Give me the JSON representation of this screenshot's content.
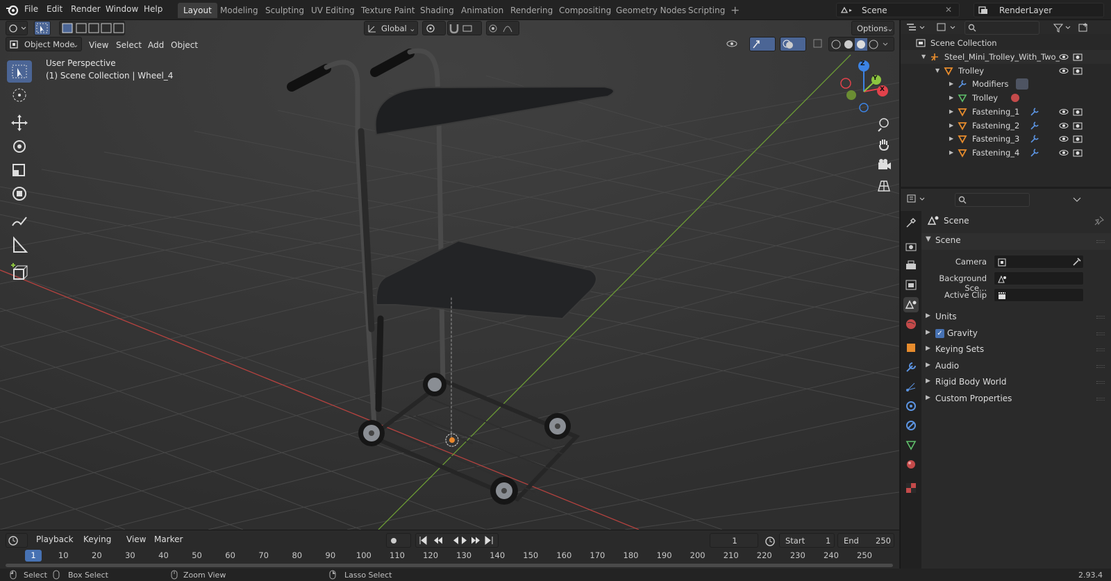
{
  "menus": [
    "File",
    "Edit",
    "Render",
    "Window",
    "Help"
  ],
  "workspace_tabs": [
    "Layout",
    "Modeling",
    "Sculpting",
    "UV Editing",
    "Texture Paint",
    "Shading",
    "Animation",
    "Rendering",
    "Compositing",
    "Geometry Nodes",
    "Scripting"
  ],
  "active_tab": "Layout",
  "scene_name": "Scene",
  "view_layer": "RenderLayer",
  "viewport": {
    "transform_orientation": "Global",
    "options_label": "Options",
    "mode": "Object Mode",
    "header_menus": [
      "View",
      "Select",
      "Add",
      "Object"
    ],
    "perspective_label": "User Perspective",
    "collection_info": "(1) Scene Collection | Wheel_4",
    "gizmo_axes": {
      "x": "X",
      "y": "Y",
      "z": "Z"
    }
  },
  "outliner": {
    "root": "Scene Collection",
    "rows": [
      {
        "label": "Steel_Mini_Trolley_With_Two_",
        "icon": "empty-icon"
      },
      {
        "label": "Trolley",
        "icon": "object-icon"
      },
      {
        "label": "Modifiers",
        "icon": "wrench-icon"
      },
      {
        "label": "Trolley",
        "icon": "mesh-data-icon"
      },
      {
        "label": "Fastening_1",
        "icon": "object-icon"
      },
      {
        "label": "Fastening_2",
        "icon": "object-icon"
      },
      {
        "label": "Fastening_3",
        "icon": "object-icon"
      },
      {
        "label": "Fastening_4",
        "icon": "object-icon"
      }
    ]
  },
  "properties": {
    "header": "Scene",
    "panel_title": "Scene",
    "camera_label": "Camera",
    "background_label": "Background Sce...",
    "active_clip_label": "Active Clip",
    "gravity_checked": true,
    "panels": [
      "Units",
      "Gravity",
      "Keying Sets",
      "Audio",
      "Rigid Body World",
      "Custom Properties"
    ]
  },
  "timeline": {
    "menus": [
      "Playback",
      "Keying",
      "View",
      "Marker"
    ],
    "current_frame": "1",
    "start_label": "Start",
    "start": "1",
    "end_label": "End",
    "end": "250",
    "frame_labels": [
      "1",
      "10",
      "20",
      "30",
      "40",
      "50",
      "60",
      "70",
      "80",
      "90",
      "100",
      "110",
      "120",
      "130",
      "140",
      "150",
      "160",
      "170",
      "180",
      "190",
      "200",
      "210",
      "220",
      "230",
      "240",
      "250"
    ]
  },
  "status": {
    "select": "Select",
    "box_select": "Box Select",
    "zoom_view": "Zoom View",
    "lasso_select": "Lasso Select",
    "version": "2.93.4"
  },
  "colors": {
    "accent": "#4b6595",
    "x_axis": "#e2424b",
    "y_axis": "#8cc43f",
    "z_axis": "#3c83e4",
    "object_orange": "#e78c2d"
  }
}
